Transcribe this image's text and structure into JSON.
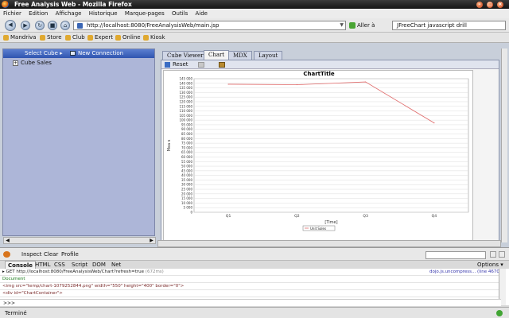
{
  "window": {
    "title": "Free Analysis Web - Mozilla Firefox"
  },
  "menu": [
    "Fichier",
    "Edition",
    "Affichage",
    "Historique",
    "Marque-pages",
    "Outils",
    "Aide"
  ],
  "nav": {
    "url": "http://localhost:8080/FreeAnalysisWeb/main.jsp",
    "go_label": "Aller à",
    "search_value": "JFreeChart javascript drill"
  },
  "bookmarks": [
    "Mandriva",
    "Store",
    "Club",
    "Expert",
    "Online",
    "Kiosk"
  ],
  "left_panel": {
    "select_cube": "Select Cube",
    "new_connection": "New Connection",
    "tree": [
      "Cube Sales"
    ]
  },
  "tabs": [
    "Cube Viewer",
    "Chart",
    "MDX",
    "Layout"
  ],
  "active_tab": "Chart",
  "chart_toolbar": {
    "reset": "Reset"
  },
  "chart_data": {
    "type": "line",
    "title": "ChartTitle",
    "xlabel": "[Time]",
    "ylabel": "Mea s",
    "categories": [
      "Q1",
      "Q2",
      "Q3",
      "Q4"
    ],
    "series": [
      {
        "name": "Unit Sales",
        "values": [
          139000,
          138500,
          141500,
          97000
        ],
        "color": "#e06a6a"
      }
    ],
    "ylim": [
      0,
      145000
    ],
    "yticks": [
      "0",
      "5 000",
      "10 000",
      "15 000",
      "20 000",
      "25 000",
      "30 000",
      "35 000",
      "40 000",
      "45 000",
      "50 000",
      "55 000",
      "60 000",
      "65 000",
      "70 000",
      "75 000",
      "80 000",
      "85 000",
      "90 000",
      "95 000",
      "100 000",
      "105 000",
      "110 000",
      "115 000",
      "120 000",
      "125 000",
      "130 000",
      "135 000",
      "140 000",
      "145 000"
    ],
    "grid": true,
    "legend": "bottom"
  },
  "firebug": {
    "inspect": "Inspect",
    "clear": "Clear",
    "profile": "Profile",
    "tabs": [
      "Console",
      "HTML",
      "CSS",
      "Script",
      "DOM",
      "Net"
    ],
    "active_tab": "Console",
    "options": "Options ▾",
    "console": {
      "get_line": "GET http://localhost:8080/FreeAnalysisWeb/Chart?refresh=true",
      "get_time": "(672ms)",
      "get_src": "dojo.js.uncompress... (line 4670)",
      "doc": "Document",
      "html1": "<img src=\"temp/chart-1079252844.png\" width=\"550\" height=\"400\" border=\"0\">",
      "html2": "<div id=\"ChartContainer\">",
      "prompt": ">>>"
    }
  },
  "status": {
    "text": "Terminé"
  }
}
